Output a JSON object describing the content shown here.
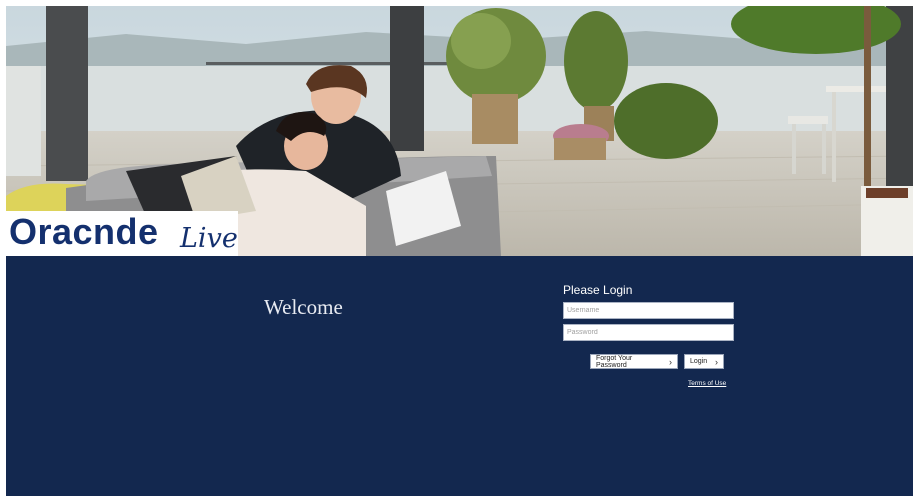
{
  "brand": {
    "word": "Oracnde",
    "script": "Live"
  },
  "main": {
    "welcome": "Welcome"
  },
  "login": {
    "title": "Please Login",
    "username_placeholder": "Username",
    "password_placeholder": "Password",
    "forgot_label": "Forgot Your Password",
    "login_label": "Login",
    "terms_label": "Terms of Use"
  },
  "icons": {
    "button_chevron": "chevron-right-icon"
  },
  "colors": {
    "panel": "#13284f",
    "brand_text": "#14306e",
    "page_bg": "#ffffff"
  }
}
